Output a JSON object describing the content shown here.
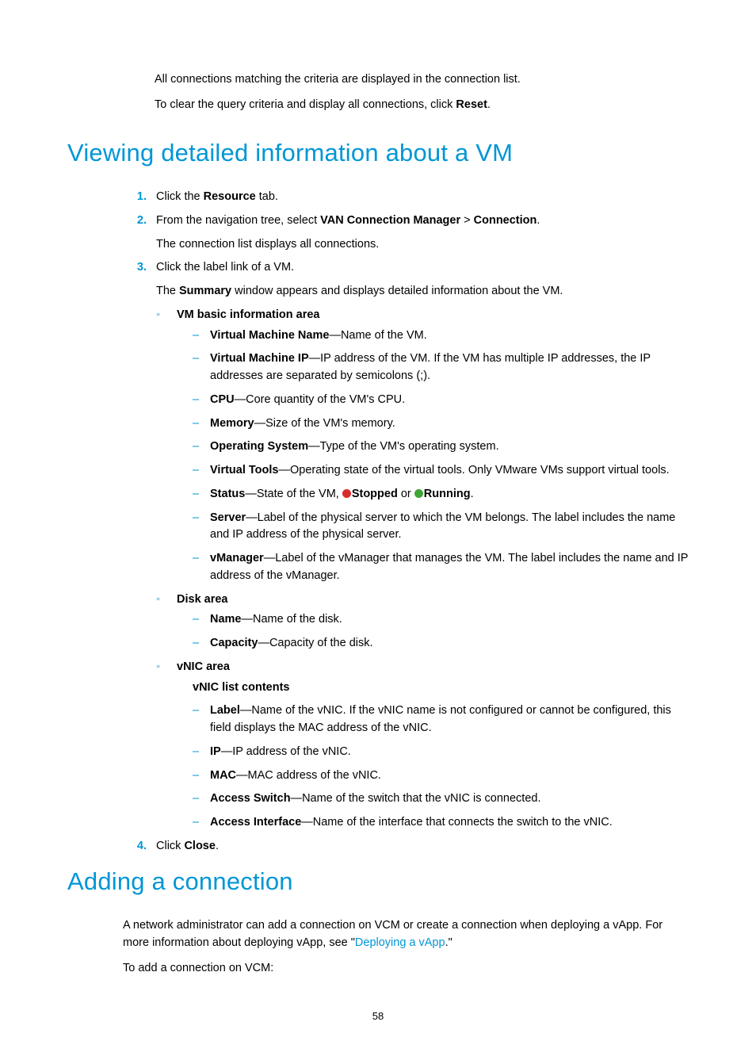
{
  "intro": {
    "line1": "All connections matching the criteria are displayed in the connection list.",
    "line2_pre": "To clear the query criteria and display all connections, click ",
    "line2_bold": "Reset",
    "line2_post": "."
  },
  "section1": {
    "heading": "Viewing detailed information about a VM",
    "steps": {
      "s1": {
        "num": "1.",
        "pre": "Click the ",
        "bold": "Resource",
        "post": " tab."
      },
      "s2": {
        "num": "2.",
        "pre": "From the navigation tree, select ",
        "b1": "VAN Connection Manager",
        "sep": " > ",
        "b2": "Connection",
        "post": ".",
        "extra": "The connection list displays all connections."
      },
      "s3": {
        "num": "3.",
        "line": "Click the label link of a VM.",
        "extra_pre": "The ",
        "extra_b": "Summary",
        "extra_post": " window appears and displays detailed information about the VM."
      },
      "s4": {
        "num": "4.",
        "pre": "Click ",
        "bold": "Close",
        "post": "."
      }
    },
    "groups": {
      "g1": {
        "title": "VM basic information area",
        "items": {
          "vmname": {
            "b": "Virtual Machine Name",
            "t": "—Name of the VM."
          },
          "vmip": {
            "b": "Virtual Machine IP",
            "t": "—IP address of the VM. If the VM has multiple IP addresses, the IP addresses are separated by semicolons (;)."
          },
          "cpu": {
            "b": "CPU",
            "t": "—Core quantity of the VM's CPU."
          },
          "memory": {
            "b": "Memory",
            "t": "—Size of the VM's memory."
          },
          "os": {
            "b": "Operating System",
            "t": "—Type of the VM's operating system."
          },
          "vtools": {
            "b": "Virtual Tools",
            "t": "—Operating state of the virtual tools. Only VMware VMs support virtual tools."
          },
          "status": {
            "b": "Status",
            "pre": "—State of the VM, ",
            "s_stopped": "Stopped",
            "mid": " or ",
            "s_running": "Running",
            "post": "."
          },
          "server": {
            "b": "Server",
            "t": "—Label of the physical server to which the VM belongs. The label includes the name and IP address of the physical server."
          },
          "vmanager": {
            "b": "vManager",
            "t": "—Label of the vManager that manages the VM. The label includes the name and IP address of the vManager."
          }
        }
      },
      "g2": {
        "title": "Disk area",
        "items": {
          "name": {
            "b": "Name",
            "t": "—Name of the disk."
          },
          "capacity": {
            "b": "Capacity",
            "t": "—Capacity of the disk."
          }
        }
      },
      "g3": {
        "title": "vNIC area",
        "subhead": "vNIC list contents",
        "items": {
          "label": {
            "b": "Label",
            "t": "—Name of the vNIC. If the vNIC name is not configured or cannot be configured, this field displays the MAC address of the vNIC."
          },
          "ip": {
            "b": "IP",
            "t": "—IP address of the vNIC."
          },
          "mac": {
            "b": "MAC",
            "t": "—MAC address of the vNIC."
          },
          "aswitch": {
            "b": "Access Switch",
            "t": "—Name of the switch that the vNIC is connected."
          },
          "aiface": {
            "b": "Access Interface",
            "t": "—Name of the interface that connects the switch to the vNIC."
          }
        }
      }
    }
  },
  "section2": {
    "heading": "Adding a connection",
    "p1_pre": "A network administrator can add a connection on VCM or create a connection when deploying a vApp. For more information about deploying vApp, see \"",
    "p1_link": "Deploying a vApp",
    "p1_post": ".\"",
    "p2": "To add a connection on VCM:"
  },
  "page_number": "58",
  "status_colors": {
    "stopped": "#d92b2b",
    "running": "#3fa535"
  }
}
